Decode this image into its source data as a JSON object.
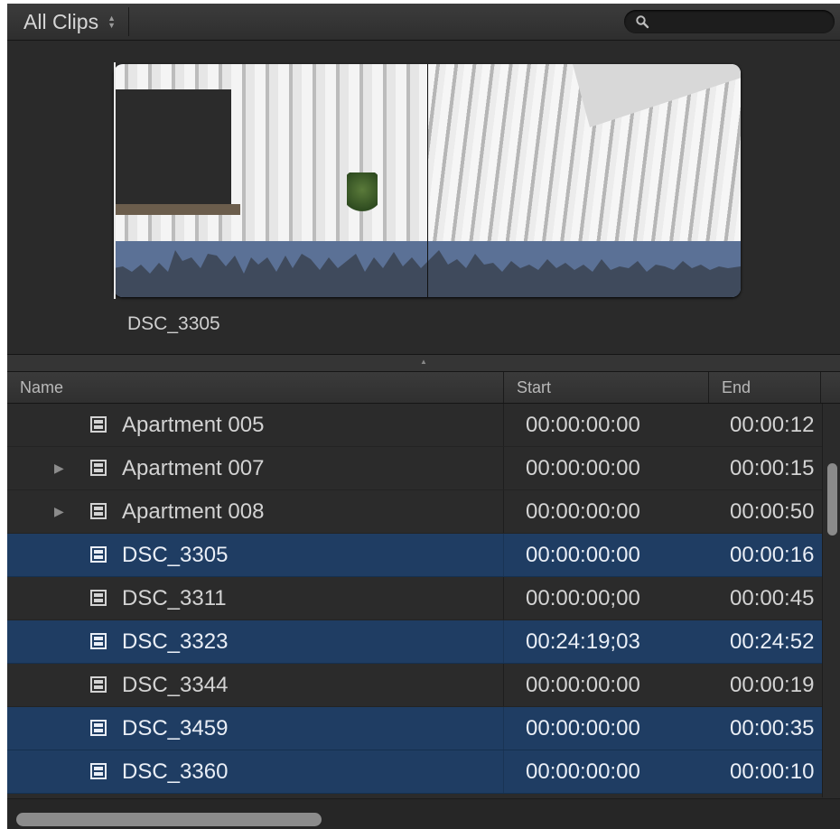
{
  "toolbar": {
    "clips_menu_label": "All Clips",
    "search_placeholder": ""
  },
  "preview": {
    "clip_name": "DSC_3305"
  },
  "list": {
    "columns": [
      "Name",
      "Start",
      "End"
    ],
    "rows": [
      {
        "name": "Apartment 005",
        "start": "00:00:00:00",
        "end": "00:00:12",
        "disclosure": false,
        "selected": false
      },
      {
        "name": "Apartment 007",
        "start": "00:00:00:00",
        "end": "00:00:15",
        "disclosure": true,
        "selected": false
      },
      {
        "name": "Apartment 008",
        "start": "00:00:00:00",
        "end": "00:00:50",
        "disclosure": true,
        "selected": false
      },
      {
        "name": "DSC_3305",
        "start": "00:00:00:00",
        "end": "00:00:16",
        "disclosure": false,
        "selected": true
      },
      {
        "name": "DSC_3311",
        "start": "00:00:00;00",
        "end": "00:00:45",
        "disclosure": false,
        "selected": false
      },
      {
        "name": "DSC_3323",
        "start": "00:24:19;03",
        "end": "00:24:52",
        "disclosure": false,
        "selected": true
      },
      {
        "name": "DSC_3344",
        "start": "00:00:00:00",
        "end": "00:00:19",
        "disclosure": false,
        "selected": false
      },
      {
        "name": "DSC_3459",
        "start": "00:00:00:00",
        "end": "00:00:35",
        "disclosure": false,
        "selected": true
      },
      {
        "name": "DSC_3360",
        "start": "00:00:00:00",
        "end": "00:00:10",
        "disclosure": false,
        "selected": true
      }
    ]
  },
  "icons": {
    "search": "search-icon",
    "film": "film-clip-icon",
    "disclosure": "disclosure-triangle-icon",
    "updown": "up-down-arrows-icon"
  },
  "colors": {
    "selection": "#1f3d63",
    "background": "#2b2b2b",
    "waveform": "#5b7196"
  }
}
